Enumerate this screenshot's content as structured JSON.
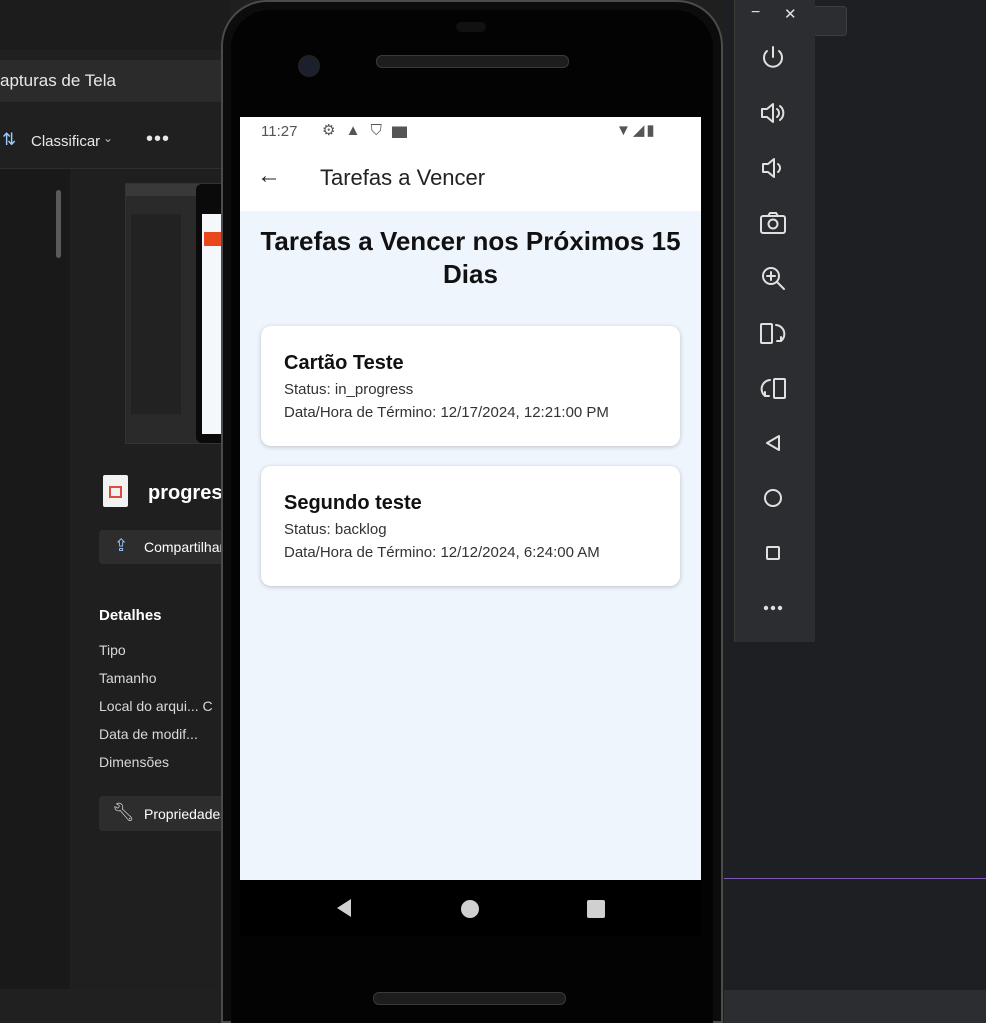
{
  "explorer": {
    "address": "apturas de Tela",
    "sort_label": "Classificar",
    "more": "•••",
    "file_name": "progress",
    "share_label": "Compartilhar",
    "details_heading": "Detalhes",
    "details": [
      "Tipo",
      "Tamanho",
      "Local do arqui...  C",
      "Data de modif...",
      "Dimensões"
    ],
    "properties_label": "Propriedades"
  },
  "emulator": {
    "minimize": "−",
    "close": "✕",
    "tools": [
      "power-icon",
      "volume-up-icon",
      "volume-down-icon",
      "camera-icon",
      "zoom-in-icon",
      "rotate-right-icon",
      "rotate-left-icon",
      "back-icon",
      "home-icon",
      "overview-icon",
      "more-icon"
    ]
  },
  "phone": {
    "status_time": "11:27",
    "appbar_title": "Tarefas a Vencer",
    "page_title": "Tarefas a Vencer nos Próximos 15 Dias",
    "tasks": [
      {
        "title": "Cartão Teste",
        "status": "Status: in_progress",
        "date": "Data/Hora de Término: 12/17/2024, 12:21:00 PM"
      },
      {
        "title": "Segundo teste",
        "status": "Status: backlog",
        "date": "Data/Hora de Término: 12/12/2024, 6:24:00 AM"
      }
    ]
  },
  "colors": {
    "screen_bg": "#eef5fc",
    "card_bg": "#ffffff",
    "explorer_bg": "#202020",
    "emulator_toolbar": "#2b2d30",
    "accent": "#9ecbff"
  }
}
